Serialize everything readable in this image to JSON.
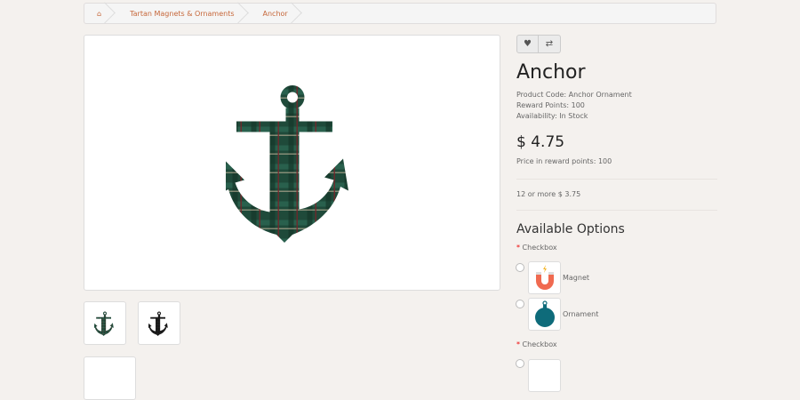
{
  "breadcrumb": {
    "home_icon": "home-icon",
    "items": [
      "Tartan Magnets & Ornaments",
      "Anchor"
    ]
  },
  "product": {
    "title": "Anchor",
    "code": "Product Code: Anchor Ornament",
    "reward_points": "Reward Points: 100",
    "availability": "Availability: In Stock",
    "price": "$ 4.75",
    "price_points": "Price in reward points: 100",
    "discount": "12 or more $ 3.75"
  },
  "actions": {
    "wishlist_icon": "heart-icon",
    "compare_icon": "exchange-icon"
  },
  "options": {
    "heading": "Available Options",
    "groups": [
      {
        "label": "Checkbox",
        "items": [
          {
            "label": "Magnet"
          },
          {
            "label": "Ornament"
          }
        ]
      },
      {
        "label": "Checkbox"
      }
    ]
  },
  "colors": {
    "accent": "#c6673a",
    "background": "#f4f1ee",
    "tartan_green": "#1f4a3a",
    "tartan_red": "#6a1f24"
  }
}
